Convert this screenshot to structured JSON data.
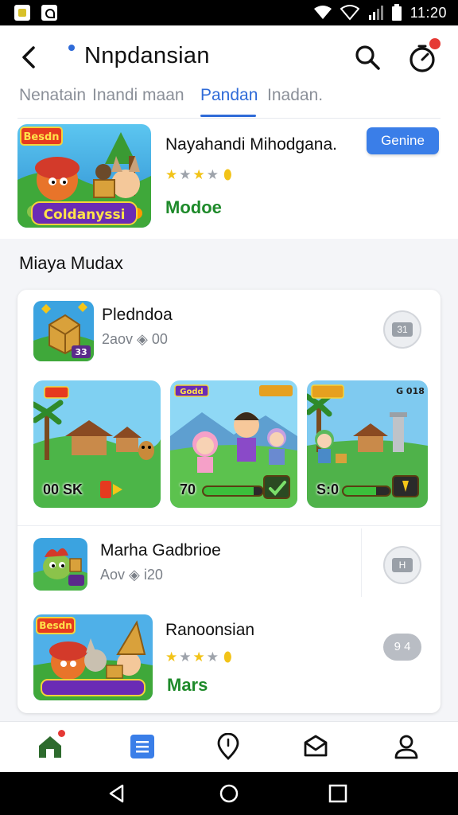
{
  "status_bar": {
    "time": "11:20"
  },
  "header": {
    "title": "Nnpdansian",
    "tabs": [
      {
        "label": "Nenatain",
        "active": false
      },
      {
        "label": "Inandi maan",
        "active": false
      },
      {
        "label": "Pandan",
        "active": true
      },
      {
        "label": "Inadan.",
        "active": false
      }
    ]
  },
  "featured": {
    "image_text": "Coldanyssi",
    "image_corner_text": "Besdn",
    "name": "Nayahandi Mihodgana.",
    "rating": 3,
    "status": "Modoe",
    "button_label": "Genine"
  },
  "section": {
    "title": "Miaya Mudax"
  },
  "card": {
    "row1": {
      "name": "Pledndoa",
      "meta": "2aov ◈ 00",
      "icon_badge": "33",
      "button_text": "31"
    },
    "screenshots": [
      {
        "label": "00 SK",
        "progress": null,
        "badge": ""
      },
      {
        "label": "70",
        "progress": 0.85,
        "badge": "Godd"
      },
      {
        "label": "S:0",
        "progress": 0.7,
        "badge": "G 018"
      }
    ],
    "row2": {
      "name": "Marha Gadbrioe",
      "meta": "Aov ◈ i20",
      "button_text": "H"
    },
    "row3": {
      "name": "Ranoonsian",
      "rating": 3,
      "status": "Mars",
      "image_text": "Besdn",
      "pill_text": "9 4"
    }
  },
  "colors": {
    "accent": "#2f6bd8",
    "success": "#1e8a2a",
    "badge": "#e53935"
  },
  "icons": {
    "back": "back-arrow-icon",
    "search": "search-icon",
    "timer": "timer-icon",
    "nav": [
      "home-icon",
      "list-icon",
      "location-pin-icon",
      "mail-icon",
      "profile-icon"
    ],
    "system": [
      "system-back-icon",
      "system-home-icon",
      "system-recents-icon"
    ]
  }
}
